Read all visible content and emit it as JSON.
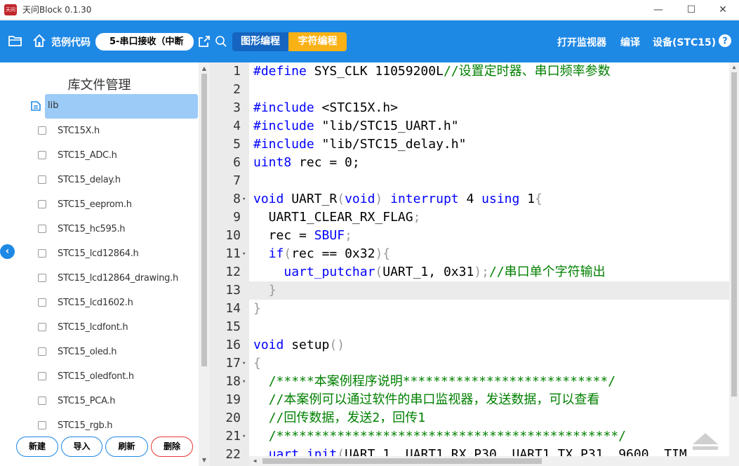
{
  "window": {
    "title": "天问Block 0.1.30",
    "logo_text": "天问",
    "minimize": "—",
    "maximize": "☐",
    "close": "✕"
  },
  "toolbar": {
    "examples_label": "范例代码",
    "example_selected": "5-串口接收（中断",
    "mode_graphic": "图形编程",
    "mode_text": "字符编程",
    "monitor_label": "打开监视器",
    "compile_label": "编译",
    "device_label": "设备(STC15)"
  },
  "library": {
    "title": "库文件管理",
    "root": "lib",
    "files": [
      "STC15X.h",
      "STC15_ADC.h",
      "STC15_delay.h",
      "STC15_eeprom.h",
      "STC15_hc595.h",
      "STC15_lcd12864.h",
      "STC15_lcd12864_drawing.h",
      "STC15_lcd1602.h",
      "STC15_lcdfont.h",
      "STC15_oled.h",
      "STC15_oledfont.h",
      "STC15_PCA.h",
      "STC15_rgb.h"
    ],
    "actions": {
      "new": "新建",
      "import": "导入",
      "refresh": "刷新",
      "delete": "删除"
    }
  },
  "editor": {
    "active_line": 13,
    "lines": [
      {
        "n": "1",
        "fold": "",
        "html": "<span class=\"kw\">#define</span> SYS_CLK 11059200L<span class=\"cm\">//设置定时器、串口频率参数</span>"
      },
      {
        "n": "2",
        "fold": "",
        "html": ""
      },
      {
        "n": "3",
        "fold": "",
        "html": "<span class=\"kw\">#include</span> &lt;STC15X.h&gt;"
      },
      {
        "n": "4",
        "fold": "",
        "html": "<span class=\"kw\">#include</span> \"lib/STC15_UART.h\""
      },
      {
        "n": "5",
        "fold": "",
        "html": "<span class=\"kw\">#include</span> \"lib/STC15_delay.h\""
      },
      {
        "n": "6",
        "fold": "",
        "html": "<span class=\"kw\">uint8</span> rec = 0;"
      },
      {
        "n": "7",
        "fold": "",
        "html": ""
      },
      {
        "n": "8",
        "fold": "▾",
        "html": "<span class=\"kw\">void</span> UART_R<span class=\"br\">(</span><span class=\"kw\">void</span><span class=\"br\">)</span> <span class=\"kw\">interrupt</span> 4 <span class=\"kw\">using</span> 1<span class=\"br\">{</span>"
      },
      {
        "n": "9",
        "fold": "",
        "html": "  UART1_CLEAR_RX_FLAG<span class=\"br\">;</span>"
      },
      {
        "n": "10",
        "fold": "",
        "html": "  rec = <span class=\"kw\">SBUF</span><span class=\"br\">;</span>"
      },
      {
        "n": "11",
        "fold": "▾",
        "html": "  <span class=\"kw\">if</span><span class=\"br\">(</span>rec == 0x32<span class=\"br\">){</span>"
      },
      {
        "n": "12",
        "fold": "",
        "html": "    <span class=\"kw\">uart_putchar</span><span class=\"br\">(</span>UART_1, 0x31<span class=\"br\">);</span><span class=\"cm\">//串口单个字符输出</span>"
      },
      {
        "n": "13",
        "fold": "",
        "html": "  <span class=\"br\">}</span>"
      },
      {
        "n": "14",
        "fold": "",
        "html": "<span class=\"br\">}</span>"
      },
      {
        "n": "15",
        "fold": "",
        "html": ""
      },
      {
        "n": "16",
        "fold": "",
        "html": "<span class=\"kw\">void</span> setup<span class=\"br\">()</span>"
      },
      {
        "n": "17",
        "fold": "▾",
        "html": "<span class=\"br\">{</span>"
      },
      {
        "n": "18",
        "fold": "▾",
        "html": "  <span class=\"cm\">/*****本案例程序说明***************************/</span>"
      },
      {
        "n": "19",
        "fold": "",
        "html": "  <span class=\"cm\">//本案例可以通过软件的串口监视器，发送数据，可以查看</span>"
      },
      {
        "n": "20",
        "fold": "",
        "html": "  <span class=\"cm\">//回传数据，发送2，回传1</span>"
      },
      {
        "n": "21",
        "fold": "▾",
        "html": "  <span class=\"cm\">/*********************************************/</span>"
      },
      {
        "n": "22",
        "fold": "",
        "html": "  <span class=\"kw\">uart_init</span><span class=\"br\">(</span>UART_1, UART1_RX_P30, UART1_TX_P31, 9600, TIM"
      }
    ]
  },
  "icons": {
    "folder": "folder-open-icon",
    "home": "home-icon",
    "share": "share-icon",
    "search": "search-icon",
    "help": "help-icon",
    "file_tree": "file-list-icon",
    "collapse": "chevron-left-icon",
    "back_to_top": "arrow-up-icon"
  },
  "colors": {
    "primary": "#1e88e5",
    "accent": "#f9b115",
    "delete": "#e53935"
  }
}
